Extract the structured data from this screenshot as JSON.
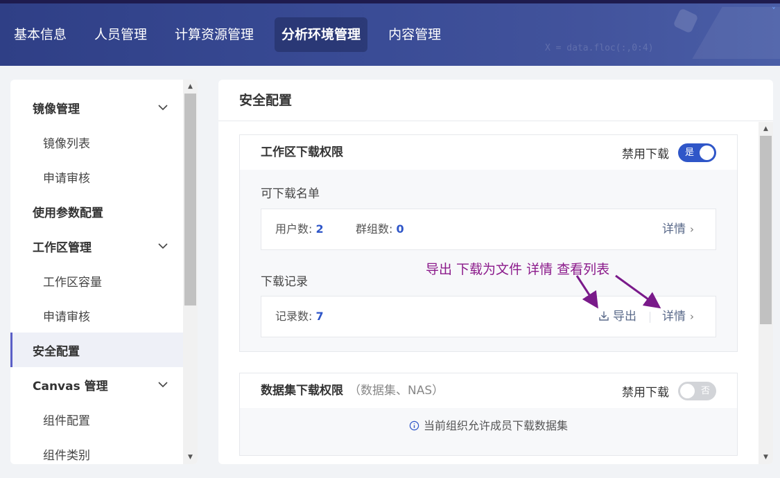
{
  "nav": {
    "items": [
      "基本信息",
      "人员管理",
      "计算资源管理",
      "分析环境管理",
      "内容管理"
    ],
    "active_index": 3,
    "bg_code": "X = data.floc(:,0:4)"
  },
  "sidebar": {
    "items": [
      {
        "label": "镜像管理",
        "type": "group",
        "expanded": true
      },
      {
        "label": "镜像列表",
        "type": "sub"
      },
      {
        "label": "申请审核",
        "type": "sub"
      },
      {
        "label": "使用参数配置",
        "type": "group"
      },
      {
        "label": "工作区管理",
        "type": "group",
        "expanded": true
      },
      {
        "label": "工作区容量",
        "type": "sub"
      },
      {
        "label": "申请审核",
        "type": "sub"
      },
      {
        "label": "安全配置",
        "type": "group",
        "active": true
      },
      {
        "label": "Canvas 管理",
        "type": "group",
        "expanded": true
      },
      {
        "label": "组件配置",
        "type": "sub"
      },
      {
        "label": "组件类别",
        "type": "sub"
      }
    ]
  },
  "main": {
    "title": "安全配置",
    "workspace": {
      "title": "工作区下载权限",
      "toggle_label": "禁用下载",
      "toggle_text": "是",
      "toggle_on": true,
      "whitelist_label": "可下载名单",
      "users_label": "用户数:",
      "users_value": "2",
      "groups_label": "群组数:",
      "groups_value": "0",
      "details_label": "详情",
      "records_label": "下载记录",
      "records_count_label": "记录数:",
      "records_count_value": "7",
      "export_label": "导出",
      "details2_label": "详情"
    },
    "dataset": {
      "title": "数据集下载权限",
      "subtitle": "（数据集、NAS）",
      "toggle_label": "禁用下载",
      "toggle_text": "否",
      "toggle_on": false,
      "notice": "当前组织允许成员下载数据集"
    }
  },
  "annotation": {
    "text": "导出 下载为文件 详情 查看列表",
    "color": "#8b1a8b"
  },
  "colors": {
    "accent": "#2f56c8",
    "header_bg": "#394b95",
    "sidebar_active_bar": "#5b5fc7"
  }
}
